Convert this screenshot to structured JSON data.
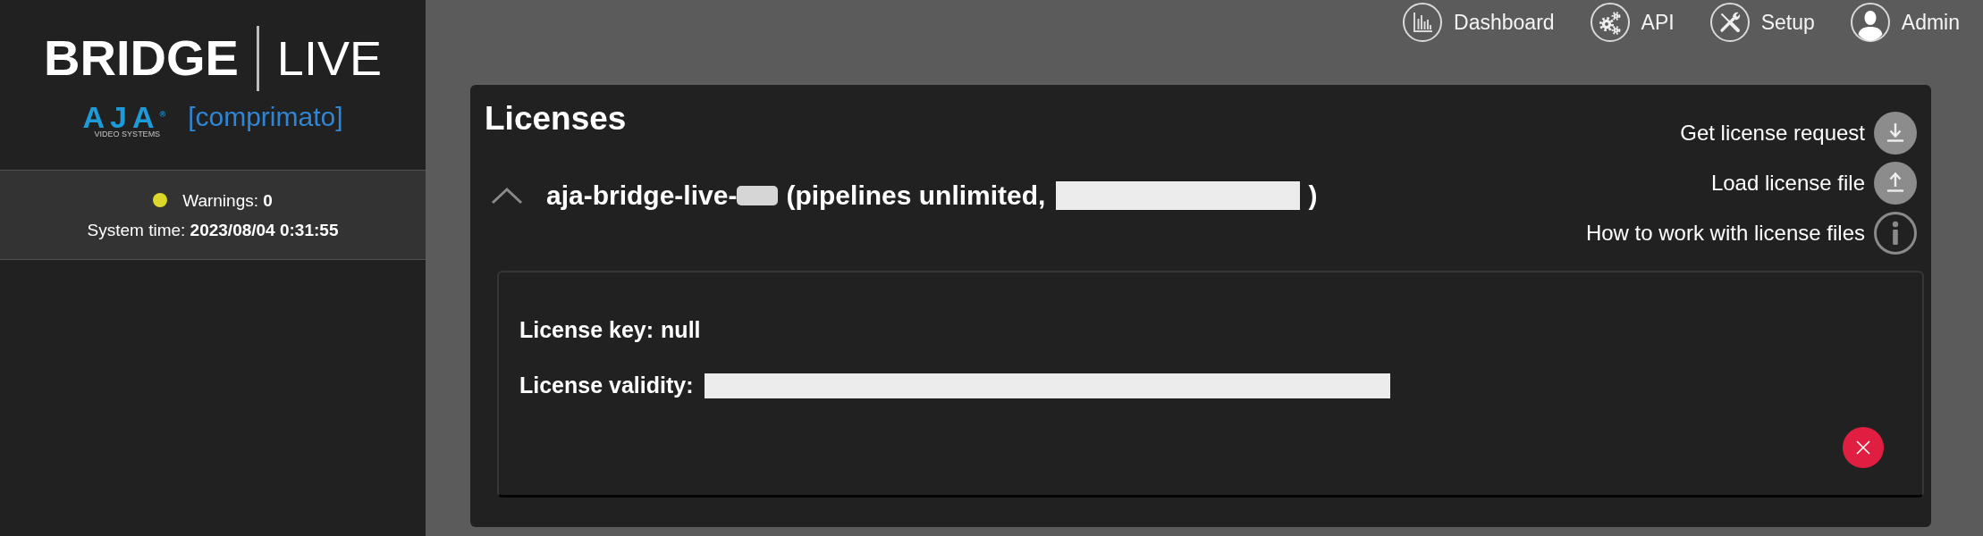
{
  "sidebar": {
    "logo": {
      "product": "BRIDGE",
      "edition": "LIVE",
      "maker": "AJA$^{®}$",
      "maker_tagline": "VIDEO SYSTEMS",
      "partner": "[comprimato]"
    },
    "status": {
      "color": "#dcd62b",
      "warnings": "Warnings: **0**",
      "time": "System time: **2023/08/04 0:31:55**"
    }
  },
  "nav": [
    {
      "kind": "chart",
      "label": "Dashboard"
    },
    {
      "kind": "gears",
      "label": "API"
    },
    {
      "kind": "tools",
      "label": "Setup"
    },
    {
      "kind": "user",
      "label": "Admin"
    }
  ],
  "licenses": {
    "title": "Licenses",
    "actions": [
      {
        "kind": "download",
        "label": "Get license request"
      },
      {
        "kind": "upload",
        "label": "Load license file"
      },
      {
        "kind": "info",
        "label": "How to work with license files"
      }
    ],
    "items": [
      {
        "expanded": true,
        "heading": [
          {
            "kind": "text",
            "text": "aja-bridge-live-"
          },
          {
            "kind": "blurred"
          },
          {
            "kind": "text",
            "text": "(pipelines unlimited,"
          },
          {
            "kind": "redacted"
          },
          {
            "kind": "text",
            "text": ")"
          }
        ],
        "fields": [
          {
            "kind": "text",
            "label": "License key:",
            "value": "null"
          },
          {
            "kind": "redacted",
            "label": "License validity:"
          }
        ]
      }
    ]
  }
}
